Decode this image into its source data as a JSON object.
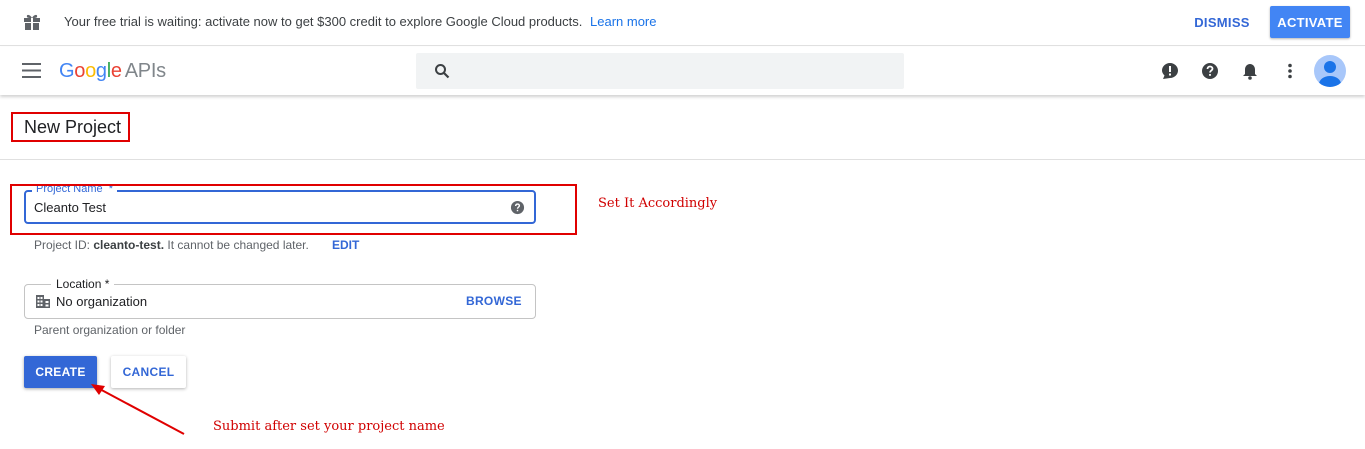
{
  "banner": {
    "message": "Your free trial is waiting: activate now to get $300 credit to explore Google Cloud products.",
    "learn_more": "Learn more",
    "dismiss_label": "DISMISS",
    "activate_label": "ACTIVATE",
    "icon": "gift-icon"
  },
  "header": {
    "logo_google": [
      "G",
      "o",
      "o",
      "g",
      "l",
      "e"
    ],
    "logo_suffix": "APIs",
    "icons": [
      "menu-icon",
      "search-icon",
      "feedback-icon",
      "help-icon",
      "notifications-icon",
      "more-vert-icon",
      "account-avatar"
    ]
  },
  "page": {
    "title": "New Project"
  },
  "project_name": {
    "label": "Project Name",
    "required_mark": "*",
    "value": "Cleanto Test",
    "id_prefix": "Project ID:",
    "id_value": "cleanto-test.",
    "id_suffix": "It cannot be changed later.",
    "edit_label": "EDIT"
  },
  "location": {
    "label": "Location *",
    "value": "No organization",
    "browse_label": "BROWSE",
    "helper": "Parent organization or folder"
  },
  "actions": {
    "create_label": "CREATE",
    "cancel_label": "CANCEL"
  },
  "annotations": {
    "field_note": "Set It Accordingly",
    "submit_note": "Submit after set your project name",
    "color": "#e00000"
  },
  "colors": {
    "primary": "#3367d6",
    "activate": "#4285f4"
  }
}
